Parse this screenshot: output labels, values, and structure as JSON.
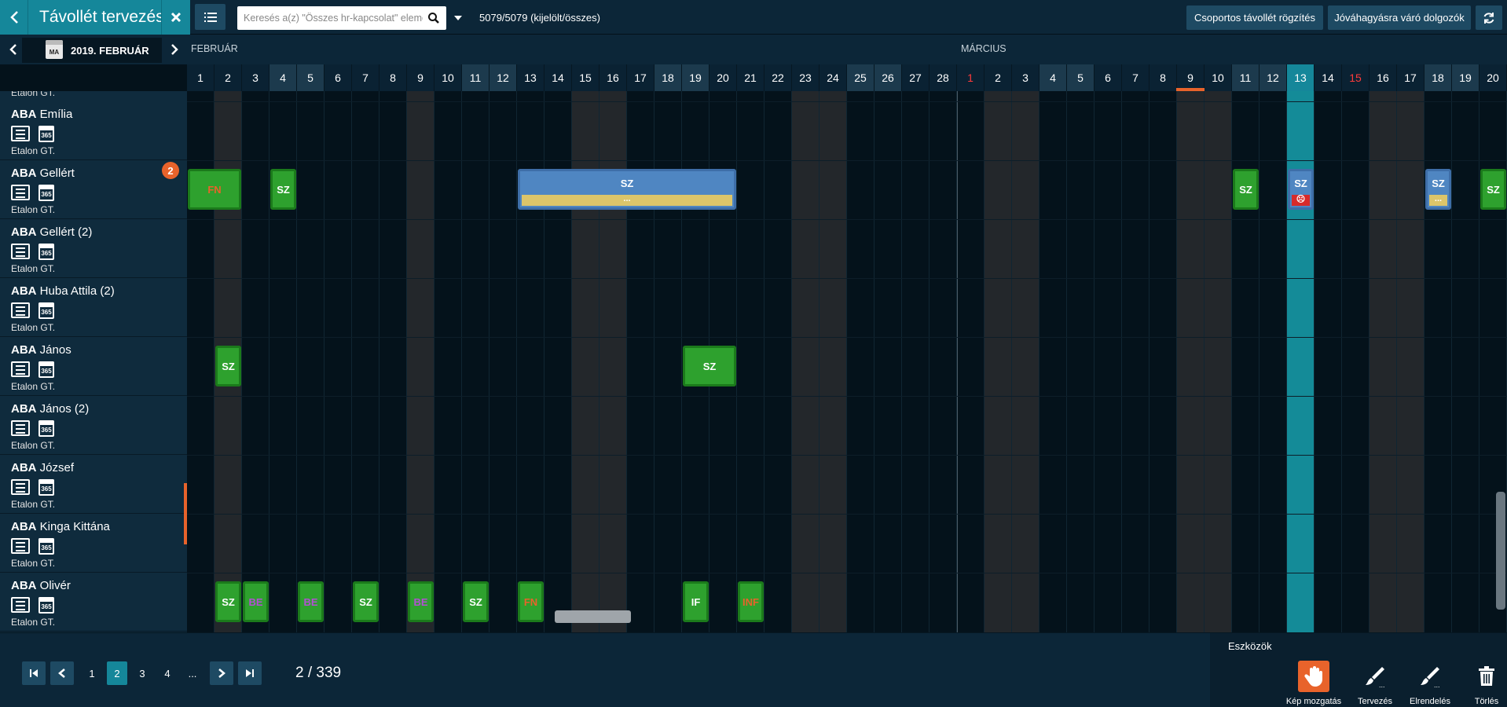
{
  "app": {
    "title": "Távollét tervezés"
  },
  "search": {
    "placeholder": "Keresés a(z) \"Összes hr-kapcsolat\" eleme"
  },
  "count_label": "5079/5079 (kijelölt/összes)",
  "toolbar": {
    "group_absence": "Csoportos távollét rögzítés",
    "pending_approval": "Jóváhagyásra váró dolgozók"
  },
  "nav": {
    "current_month": "2019. FEBRUÁR",
    "calendar_badge": "MA"
  },
  "months": {
    "feb": "FEBRUÁR",
    "mar": "MÁRCIUS"
  },
  "days": [
    "1",
    "2",
    "3",
    "4",
    "5",
    "6",
    "7",
    "8",
    "9",
    "10",
    "11",
    "12",
    "13",
    "14",
    "15",
    "16",
    "17",
    "18",
    "19",
    "20",
    "21",
    "22",
    "23",
    "24",
    "25",
    "26",
    "27",
    "28",
    "1",
    "2",
    "3",
    "4",
    "5",
    "6",
    "7",
    "8",
    "9",
    "10",
    "11",
    "12",
    "13",
    "14",
    "15",
    "16",
    "17",
    "18",
    "19",
    "20"
  ],
  "red_day_indices": [
    28,
    42
  ],
  "dark_day_indices": [
    1,
    8,
    14,
    15,
    22,
    23,
    29,
    30,
    36,
    37,
    43,
    44
  ],
  "today_index": 40,
  "weekend_header_indices": [
    3,
    4,
    10,
    11,
    17,
    18,
    24,
    25,
    31,
    32,
    38,
    39,
    45,
    46
  ],
  "sidebar": {
    "partial_top": "Etalon GT.",
    "employees": [
      {
        "last": "ABA",
        "first": "Emília",
        "sub": "Etalon GT.",
        "cal": "365"
      },
      {
        "last": "ABA",
        "first": "Gellért",
        "sub": "Etalon GT.",
        "cal": "365",
        "badge": "2"
      },
      {
        "last": "ABA",
        "first": "Gellért (2)",
        "sub": "Etalon GT.",
        "cal": "365"
      },
      {
        "last": "ABA",
        "first": "Huba Attila (2)",
        "sub": "Etalon GT.",
        "cal": "365"
      },
      {
        "last": "ABA",
        "first": "János",
        "sub": "Etalon GT.",
        "cal": "365"
      },
      {
        "last": "ABA",
        "first": "János (2)",
        "sub": "Etalon GT.",
        "cal": "365"
      },
      {
        "last": "ABA",
        "first": "József",
        "sub": "Etalon GT.",
        "cal": "365"
      },
      {
        "last": "ABA",
        "first": "Kinga Kittána",
        "sub": "Etalon GT.",
        "cal": "365"
      },
      {
        "last": "ABA",
        "first": "Olivér",
        "sub": "Etalon GT.",
        "cal": "365"
      }
    ]
  },
  "events": [
    {
      "row": 1,
      "start": 0,
      "span": 2,
      "label": "FN",
      "kind": "fn"
    },
    {
      "row": 1,
      "start": 3,
      "span": 1,
      "label": "SZ",
      "kind": "sz"
    },
    {
      "row": 1,
      "start": 12,
      "span": 8,
      "label": "SZ",
      "kind": "blue",
      "bar": "..."
    },
    {
      "row": 1,
      "start": 38,
      "span": 1,
      "label": "SZ",
      "kind": "sz"
    },
    {
      "row": 1,
      "start": 40,
      "span": 1,
      "label": "SZ",
      "kind": "blue",
      "red": "☹"
    },
    {
      "row": 1,
      "start": 45,
      "span": 1,
      "label": "SZ",
      "kind": "blue",
      "bar": "..."
    },
    {
      "row": 1,
      "start": 47,
      "span": 1,
      "label": "SZ",
      "kind": "sz"
    },
    {
      "row": 4,
      "start": 1,
      "span": 1,
      "label": "SZ",
      "kind": "sz"
    },
    {
      "row": 4,
      "start": 18,
      "span": 2,
      "label": "SZ",
      "kind": "sz"
    },
    {
      "row": 8,
      "start": 1,
      "span": 1,
      "label": "SZ",
      "kind": "sz"
    },
    {
      "row": 8,
      "start": 2,
      "span": 1,
      "label": "BE",
      "kind": "be"
    },
    {
      "row": 8,
      "start": 4,
      "span": 1,
      "label": "BE",
      "kind": "be"
    },
    {
      "row": 8,
      "start": 6,
      "span": 1,
      "label": "SZ",
      "kind": "sz"
    },
    {
      "row": 8,
      "start": 8,
      "span": 1,
      "label": "BE",
      "kind": "be"
    },
    {
      "row": 8,
      "start": 10,
      "span": 1,
      "label": "SZ",
      "kind": "sz"
    },
    {
      "row": 8,
      "start": 12,
      "span": 1,
      "label": "FN",
      "kind": "fn"
    },
    {
      "row": 8,
      "start": 18,
      "span": 1,
      "label": "IF",
      "kind": "sz"
    },
    {
      "row": 8,
      "start": 20,
      "span": 1,
      "label": "INF",
      "kind": "fn"
    }
  ],
  "pagination": {
    "pages": [
      "1",
      "2",
      "3",
      "4",
      "..."
    ],
    "current": "2",
    "info": "2 / 339"
  },
  "tools": {
    "title": "Eszközök",
    "items": [
      {
        "label": "Kép mozgatás",
        "icon": "hand-icon",
        "active": true
      },
      {
        "label": "Tervezés",
        "icon": "brush-icon"
      },
      {
        "label": "Elrendelés",
        "icon": "brush-icon"
      },
      {
        "label": "Törlés",
        "icon": "trash-icon"
      }
    ]
  },
  "colors": {
    "accent": "#15879a",
    "orange": "#e8632b",
    "green": "#2ea12e",
    "blue": "#4f86c2",
    "yellow": "#dcc56a",
    "purple": "#b34fd4"
  }
}
